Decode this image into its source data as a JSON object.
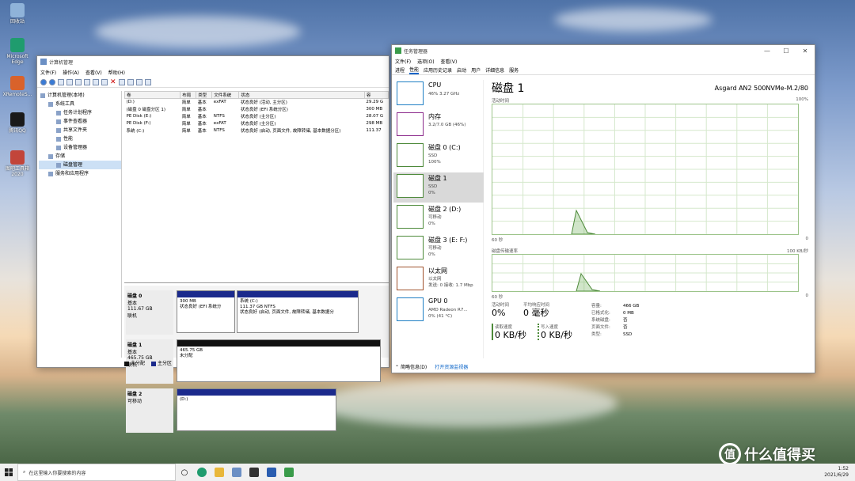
{
  "desktop": {
    "icons": [
      {
        "label": "回收站",
        "color": "#8fb3d9"
      },
      {
        "label": "Microsoft Edge",
        "color": "#1f9c6e"
      },
      {
        "label": "XRemoteS...",
        "color": "#d9622b"
      },
      {
        "label": "腾讯QQ",
        "color": "#1a1a1a"
      },
      {
        "label": "图吧工具箱 2020",
        "color": "#c2453a"
      }
    ]
  },
  "compmgmt": {
    "title": "计算机管理",
    "menu": [
      "文件(F)",
      "操作(A)",
      "查看(V)",
      "帮助(H)"
    ],
    "tree": [
      {
        "label": "计算机管理(本地)",
        "indent": 0
      },
      {
        "label": "系统工具",
        "indent": 1
      },
      {
        "label": "任务计划程序",
        "indent": 2
      },
      {
        "label": "事件查看器",
        "indent": 2
      },
      {
        "label": "共享文件夹",
        "indent": 2
      },
      {
        "label": "性能",
        "indent": 2
      },
      {
        "label": "设备管理器",
        "indent": 2
      },
      {
        "label": "存储",
        "indent": 1
      },
      {
        "label": "磁盘管理",
        "indent": 2
      },
      {
        "label": "服务和应用程序",
        "indent": 1
      }
    ],
    "columns": [
      "卷",
      "布局",
      "类型",
      "文件系统",
      "状态",
      "容"
    ],
    "rows": [
      [
        "(D:)",
        "简单",
        "基本",
        "exFAT",
        "状态良好 (活动, 主分区)",
        "29.29 G"
      ],
      [
        "(磁盘 0 磁盘分区 1)",
        "简单",
        "基本",
        "",
        "状态良好 (EFI 系统分区)",
        "300 MB"
      ],
      [
        "PE Disk (E:)",
        "简单",
        "基本",
        "NTFS",
        "状态良好 (主分区)",
        "28.07 G"
      ],
      [
        "PE Disk (F:)",
        "简单",
        "基本",
        "exFAT",
        "状态良好 (主分区)",
        "298 MB"
      ],
      [
        "系统 (C:)",
        "简单",
        "基本",
        "NTFS",
        "状态良好 (启动, 页面文件, 故障转储, 基本数据分区)",
        "111.37"
      ]
    ],
    "disks": [
      {
        "name": "磁盘 0",
        "type": "基本",
        "size": "111.67 GB",
        "status": "联机",
        "parts": [
          {
            "l1": "300 MB",
            "l2": "状态良好 (EFI 系统分",
            "l3": "",
            "color": "#1b2a8c"
          },
          {
            "l1": "系统  (C:)",
            "l2": "111.37 GB NTFS",
            "l3": "状态良好 (启动, 页面文件, 故障转储, 基本数据分",
            "color": "#1b2a8c"
          }
        ]
      },
      {
        "name": "磁盘 1",
        "type": "基本",
        "size": "465.75 GB",
        "status": "联机",
        "parts": [
          {
            "l1": "465.75 GB",
            "l2": "未分配",
            "l3": "",
            "color": "#111111"
          }
        ]
      },
      {
        "name": "磁盘 2",
        "type": "可移动",
        "size": "",
        "status": "",
        "parts": [
          {
            "l1": "(D:)",
            "l2": "",
            "l3": "",
            "color": "#1b2a8c"
          }
        ]
      }
    ],
    "legend": [
      {
        "label": "未分配",
        "color": "#111111"
      },
      {
        "label": "主分区",
        "color": "#1b2a8c"
      }
    ]
  },
  "taskmgr": {
    "title": "任务管理器",
    "menu": [
      "文件(F)",
      "选项(O)",
      "查看(V)"
    ],
    "tabs": [
      "进程",
      "性能",
      "应用历史记录",
      "启动",
      "用户",
      "详细信息",
      "服务"
    ],
    "active_tab": "性能",
    "items": [
      {
        "name": "CPU",
        "sub1": "46%  3.27 GHz",
        "sub2": "",
        "color": "#1f7fc4"
      },
      {
        "name": "内存",
        "sub1": "3.2/7.0 GB (46%)",
        "sub2": "",
        "color": "#8b2a8b"
      },
      {
        "name": "磁盘 0 (C:)",
        "sub1": "SSD",
        "sub2": "100%",
        "color": "#4d8a3a"
      },
      {
        "name": "磁盘 1",
        "sub1": "SSD",
        "sub2": "0%",
        "color": "#4d8a3a"
      },
      {
        "name": "磁盘 2 (D:)",
        "sub1": "可移动",
        "sub2": "0%",
        "color": "#4d8a3a"
      },
      {
        "name": "磁盘 3 (E: F:)",
        "sub1": "可移动",
        "sub2": "0%",
        "color": "#4d8a3a"
      },
      {
        "name": "以太网",
        "sub1": "以太网",
        "sub2": "发送: 0 接收: 1.7 Mbp",
        "color": "#a0522d"
      },
      {
        "name": "GPU 0",
        "sub1": "AMD Radeon R7...",
        "sub2": "0% (41 °C)",
        "color": "#1f7fc4"
      }
    ],
    "selected": 3,
    "detail": {
      "title": "磁盘 1",
      "model": "Asgard AN2 500NVMe-M.2/80",
      "chart1_label": "活动时间",
      "chart1_max": "100%",
      "chart1_time": "60 秒",
      "chart1_min": "0",
      "chart2_label": "磁盘传输速率",
      "chart2_max": "100 KB/秒",
      "chart2_time": "60 秒",
      "chart2_min": "0",
      "active_time_label": "活动时间",
      "active_time": "0%",
      "resp_label": "平均响应时间",
      "resp": "0 毫秒",
      "read_label": "读取速度",
      "read": "0 KB/秒",
      "write_label": "写入速度",
      "write": "0 KB/秒",
      "kv": [
        [
          "容量:",
          "466 GB"
        ],
        [
          "已格式化:",
          "0 MB"
        ],
        [
          "系统磁盘:",
          "否"
        ],
        [
          "页面文件:",
          "否"
        ],
        [
          "类型:",
          "SSD"
        ]
      ],
      "activity_series": [
        0,
        0,
        0,
        0,
        0,
        0,
        0,
        0,
        0,
        0,
        0,
        0,
        0,
        0,
        0,
        0,
        0,
        0,
        0,
        0,
        0,
        0,
        0,
        0,
        0,
        0,
        0,
        0,
        0,
        0,
        0,
        0,
        0,
        0,
        0,
        0,
        0,
        0,
        0,
        0,
        0,
        0,
        0,
        0,
        0,
        0,
        0,
        0,
        0,
        0,
        0,
        0,
        0,
        0,
        0,
        0,
        0,
        0,
        0,
        0,
        0,
        0,
        0,
        0,
        0,
        0,
        0,
        0,
        0,
        0,
        0,
        0,
        0,
        0,
        0,
        0,
        0,
        0,
        0,
        0,
        0,
        0,
        0,
        0,
        0,
        0,
        0,
        0,
        0,
        0,
        0,
        0,
        0,
        0,
        0,
        0,
        0,
        0,
        0,
        0,
        0,
        0,
        0,
        0,
        0,
        0,
        0,
        0,
        0,
        0,
        0,
        0,
        0,
        0,
        0,
        0,
        0,
        0,
        0,
        0,
        0,
        0,
        0,
        0,
        0,
        0,
        0,
        0,
        0,
        0,
        0,
        0,
        0,
        0,
        0,
        0,
        0,
        0,
        0,
        0,
        0,
        0,
        0,
        0,
        0,
        0,
        0,
        0,
        0,
        0,
        0,
        0,
        0,
        0,
        0,
        0,
        0,
        0,
        0,
        0,
        0,
        0,
        0,
        0,
        0,
        0,
        0,
        0,
        0,
        0,
        0,
        0,
        0,
        0,
        0,
        0,
        0,
        0,
        0,
        0,
        0,
        0,
        0,
        0,
        0,
        0,
        0,
        0,
        0,
        0,
        0,
        0,
        0,
        0,
        0,
        0,
        0,
        0,
        0,
        0
      ]
    },
    "footer_less": "简略信息(D)",
    "footer_link": "打开资源监视器"
  },
  "taskbar": {
    "search": "在这里输入你要搜索的内容",
    "time": "1:52",
    "date": "2021/6/29"
  },
  "watermark": "什么值得买"
}
